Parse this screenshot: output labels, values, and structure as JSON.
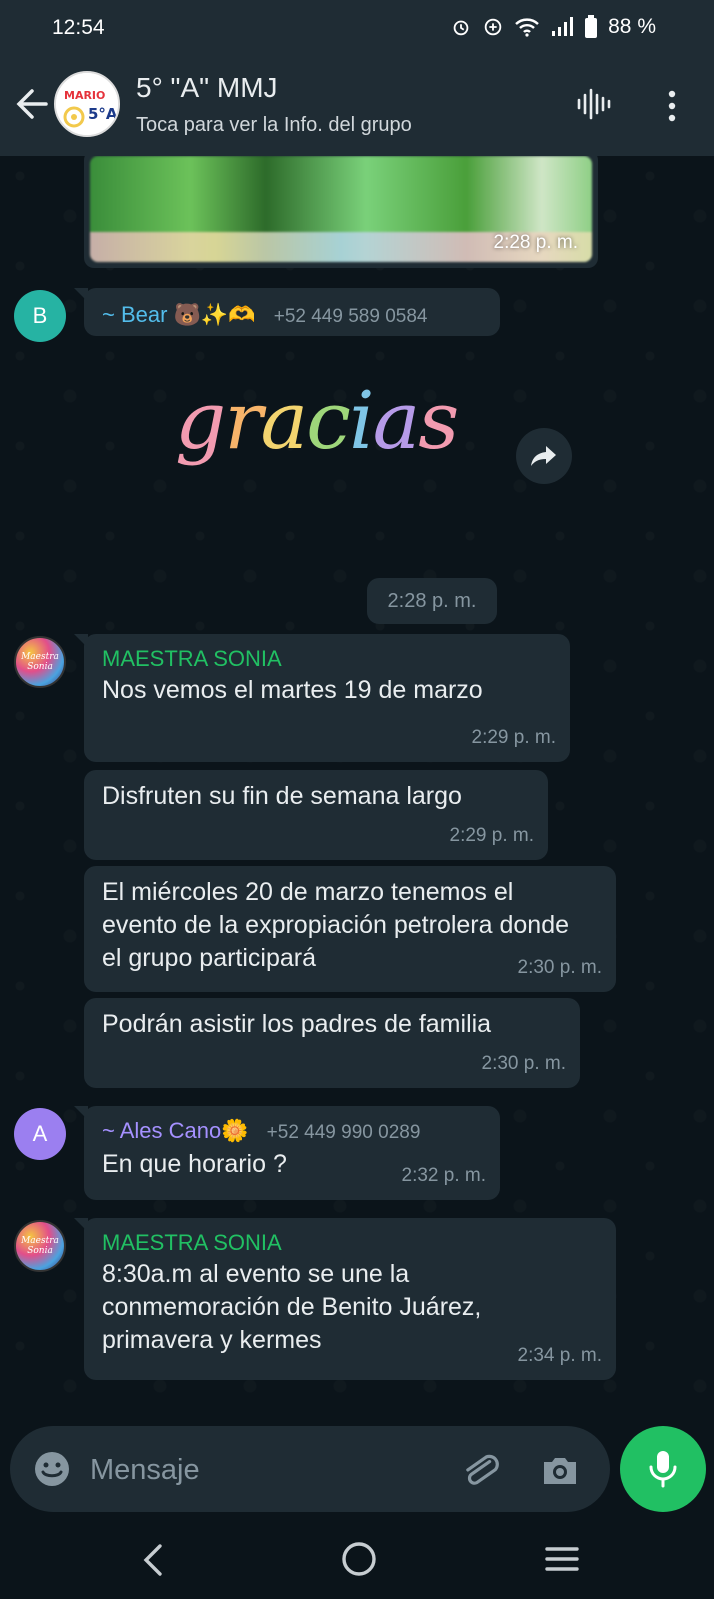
{
  "status_bar": {
    "time": "12:54",
    "battery": "88 %"
  },
  "header": {
    "title": "5° \"A\" MMJ",
    "subtitle": "Toca para ver la Info. del grupo",
    "avatar_text_top": "MARIO",
    "avatar_text_bottom": "5°A"
  },
  "messages": {
    "image_time": "2:28 p. m.",
    "bear": {
      "avatar_letter": "B",
      "sender": "~ Bear 🐻✨🫶",
      "phone": "+52 449 589 0584",
      "sticker_time": "2:28 p. m."
    },
    "sonia1": {
      "sender": "MAESTRA SONIA",
      "msgs": [
        {
          "text": "Nos vemos el martes 19 de marzo",
          "time": "2:29 p. m."
        },
        {
          "text": "Disfruten su fin de semana largo",
          "time": "2:29 p. m."
        },
        {
          "text": "El miércoles 20 de marzo tenemos el evento de la expropiación petrolera donde el grupo participará",
          "time": "2:30 p. m."
        },
        {
          "text": "Podrán asistir los padres de familia",
          "time": "2:30 p. m."
        }
      ]
    },
    "ales": {
      "avatar_letter": "A",
      "sender": "~ Ales Cano🌼",
      "phone": "+52 449 990 0289",
      "text": "En que horario ?",
      "time": "2:32 p. m."
    },
    "sonia2": {
      "sender": "MAESTRA SONIA",
      "text": "8:30a.m al evento se une la conmemoración de Benito Juárez, primavera y kermes",
      "time": "2:34 p. m."
    }
  },
  "sticker": {
    "letters": [
      "g",
      "r",
      "a",
      "c",
      "i",
      "a",
      "s"
    ]
  },
  "avatar_sonia_text": "Maestra Sonia",
  "input": {
    "placeholder": "Mensaje"
  },
  "colors": {
    "background": "#0b141a",
    "bubble": "#1f2c34",
    "accent_green": "#21c063",
    "sender_teal": "#53bdeb",
    "sender_purple": "#a591ff"
  },
  "icons": [
    "back-arrow-icon",
    "voice-wave-icon",
    "more-vert-icon",
    "forward-icon",
    "emoji-icon",
    "attach-clip-icon",
    "camera-icon",
    "mic-icon",
    "nav-back-icon",
    "nav-home-icon",
    "nav-recent-icon",
    "alarm-icon",
    "data-saver-icon",
    "wifi-icon",
    "signal-icon",
    "battery-icon"
  ]
}
